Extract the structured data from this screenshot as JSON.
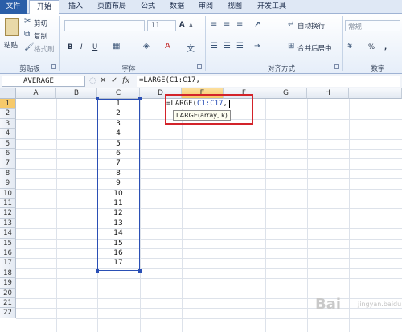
{
  "ribbon_tabs": [
    "文件",
    "开始",
    "插入",
    "页面布局",
    "公式",
    "数据",
    "审阅",
    "视图",
    "开发工具"
  ],
  "clipboard": {
    "paste": "粘贴",
    "cut": "剪切",
    "copy": "复制",
    "format_painter": "格式刷",
    "group": "剪贴板"
  },
  "font": {
    "size": "11",
    "group": "字体",
    "bold": "B",
    "italic": "I",
    "underline": "U",
    "grow": "A",
    "shrink": "A"
  },
  "alignment": {
    "wrap": "自动换行",
    "merge": "合并后居中",
    "group": "对齐方式"
  },
  "number": {
    "format": "常规",
    "percent": "%",
    "comma": ",",
    "group": "数字"
  },
  "formula_bar": {
    "name_box": "AVERAGE",
    "cancel": "✕",
    "enter": "✓",
    "fx": "fx",
    "content": "=LARGE(C1:C17,"
  },
  "columns": [
    "A",
    "B",
    "C",
    "D",
    "E",
    "F",
    "G",
    "H",
    "I"
  ],
  "rows": [
    "1",
    "2",
    "3",
    "4",
    "5",
    "6",
    "7",
    "8",
    "9",
    "10",
    "11",
    "12",
    "13",
    "14",
    "15",
    "16",
    "17",
    "18",
    "19",
    "20",
    "21",
    "22"
  ],
  "c_values": [
    "1",
    "2",
    "3",
    "4",
    "5",
    "6",
    "7",
    "8",
    "9",
    "10",
    "11",
    "12",
    "13",
    "14",
    "15",
    "16",
    "17"
  ],
  "edit_cell": {
    "prefix": "=LARGE(",
    "range": "C1:C17",
    "suffix": ",",
    "tooltip": "LARGE(array, k)"
  },
  "watermark": {
    "text": "Bai",
    "sub": "jingyan.baidu.com"
  },
  "colors": {
    "file_tab": "#2a5ea8",
    "range_border": "#2a4fb5",
    "highlight": "#d3232a"
  }
}
